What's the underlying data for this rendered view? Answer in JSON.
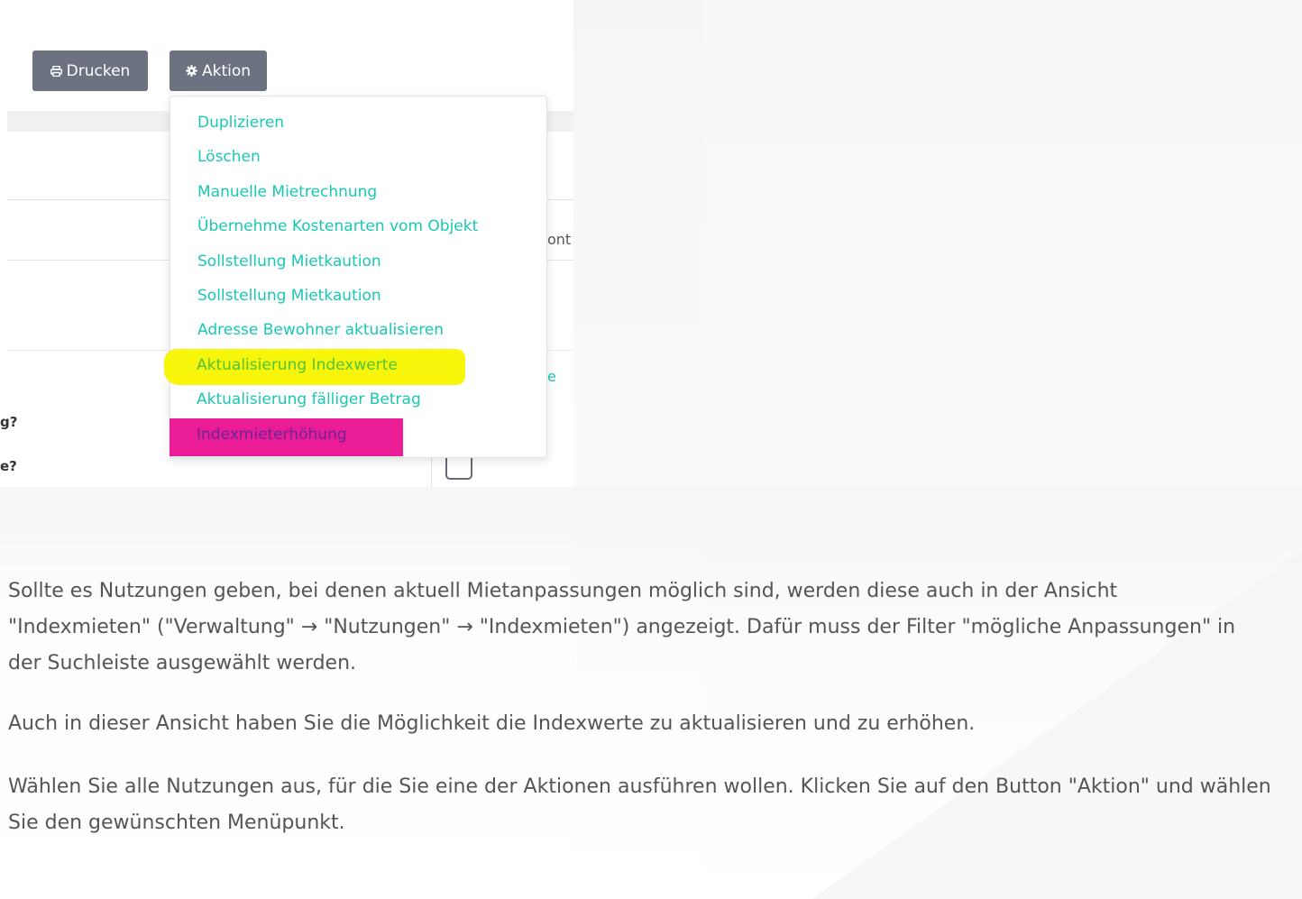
{
  "toolbar": {
    "print_label": "Drucken",
    "action_label": "Aktion",
    "print_icon": "printer-icon",
    "action_icon": "gear-icon"
  },
  "dropdown": {
    "items": [
      "Duplizieren",
      "Löschen",
      "Manuelle Mietrechnung",
      "Übernehme Kostenarten vom Objekt",
      "Sollstellung Mietkaution",
      "Sollstellung Mietkaution",
      "Adresse Bewohner aktualisieren",
      "Aktualisierung Indexwerte",
      "Aktualisierung fälliger Betrag",
      "Indexmieterhöhung"
    ],
    "highlight_colors": {
      "yellow": "#f6f50a",
      "magenta": "#ea1d96"
    },
    "link_color": "#19c8b3"
  },
  "background_fragments": {
    "right_header_fragment": "ont",
    "right_link_fragment": "e",
    "question_1": "g?",
    "question_2": "e?"
  },
  "article": {
    "paragraph_1": "Sollte es Nutzungen geben, bei denen aktuell Mietanpassungen möglich sind, werden diese auch in der Ansicht \"Indexmieten\" (\"Verwaltung\" → \"Nutzungen\" → \"Indexmieten\") angezeigt. Dafür muss der Filter \"mögliche Anpassungen\" in der Suchleiste ausgewählt werden.",
    "paragraph_2": "Auch in dieser Ansicht haben Sie die Möglichkeit die Indexwerte zu aktualisieren und zu erhöhen.",
    "paragraph_3": "Wählen Sie alle Nutzungen aus, für die Sie eine der Aktionen ausführen wollen. Klicken Sie auf den Button \"Aktion\" und wählen Sie den gewünschten Menüpunkt."
  }
}
